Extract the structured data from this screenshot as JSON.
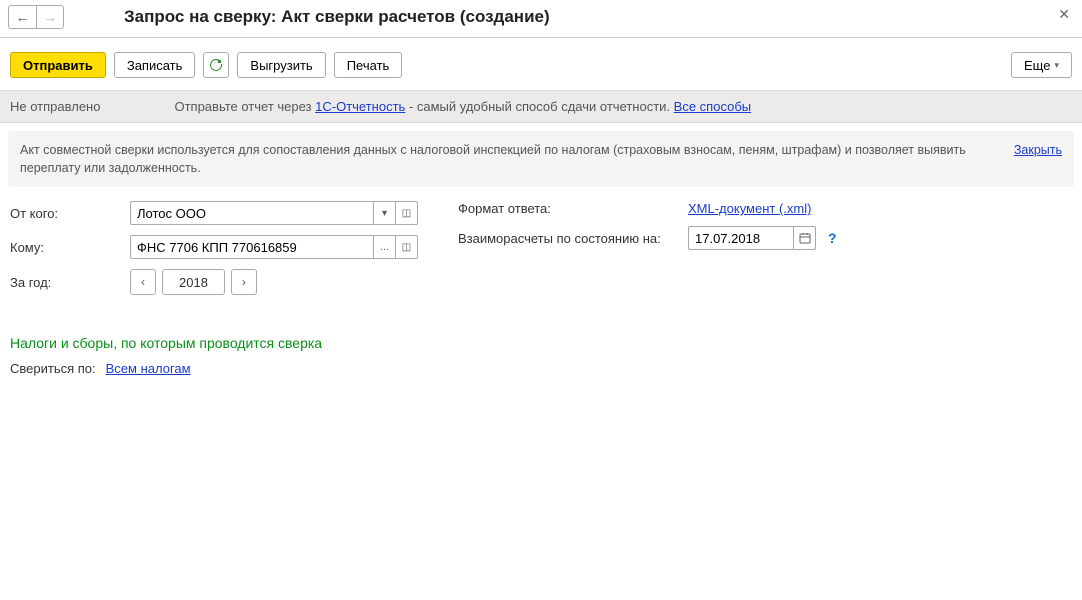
{
  "window": {
    "title": "Запрос на сверку: Акт сверки расчетов (создание)"
  },
  "toolbar": {
    "send": "Отправить",
    "save": "Записать",
    "upload": "Выгрузить",
    "print": "Печать",
    "more": "Еще"
  },
  "status": {
    "state": "Не отправлено",
    "prefix": "Отправьте отчет через ",
    "link1": "1С-Отчетность",
    "middle": " - самый удобный способ сдачи отчетности. ",
    "link2": "Все способы"
  },
  "banner": {
    "text": "Акт совместной сверки используется для сопоставления данных с налоговой инспекцией по налогам (страховым взносам, пеням, штрафам) и позволяет выявить переплату или задолженность.",
    "close": "Закрыть"
  },
  "form": {
    "from_label": "От кого:",
    "from_value": "Лотос ООО",
    "to_label": "Кому:",
    "to_value": "ФНС 7706 КПП 770616859",
    "year_label": "За год:",
    "year_value": "2018",
    "format_label": "Формат ответа:",
    "format_link": "XML-документ (.xml)",
    "date_label": "Взаиморасчеты по состоянию на:",
    "date_value": "17.07.2018"
  },
  "section": {
    "title": "Налоги и сборы, по которым проводится сверка",
    "filter_label": "Свериться по:",
    "filter_link": "Всем налогам"
  }
}
